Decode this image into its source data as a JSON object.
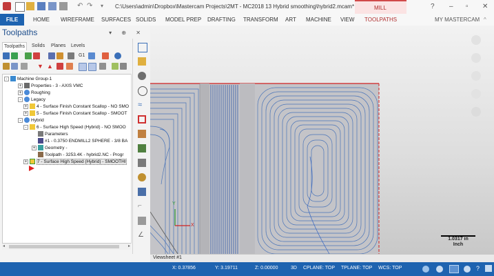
{
  "window": {
    "title": "C:\\Users\\admin\\Dropbox\\Mastercam Projects\\2MT - MC2018 13 Hybrid smoothing\\hybrid2.mcam* - Masterc...",
    "context_tab": "MILL",
    "accent": "#1e63b0",
    "context_color": "#b03030"
  },
  "ribbon": {
    "file": "FILE",
    "tabs": [
      "HOME",
      "WIREFRAME",
      "SURFACES",
      "SOLIDS",
      "MODEL PREP",
      "DRAFTING",
      "TRANSFORM",
      "ART",
      "MACHINE",
      "VIEW",
      "TOOLPATHS"
    ],
    "active_tab": "TOOLPATHS",
    "my_mastercam": "MY MASTERCAM"
  },
  "panel": {
    "title": "Toolpaths",
    "controls": "▾ ⊕ ✕",
    "tabs": [
      "Toolpaths",
      "Solids",
      "Planes",
      "Levels"
    ],
    "active_tab": "Toolpaths"
  },
  "tree": {
    "nodes": [
      {
        "label": "Machine Group-1",
        "icon": "machine-group-icon"
      },
      {
        "label": "Properties - 3 - AXIS VMC",
        "icon": "properties-icon"
      },
      {
        "label": "Roughing",
        "icon": "group-icon"
      },
      {
        "label": "Legacy",
        "icon": "group-icon"
      },
      {
        "label": "4 - Surface Finish Constant Scallop - NO SMO",
        "icon": "folder-icon"
      },
      {
        "label": "5 - Surface Finish Constant Scallop - SMOOT",
        "icon": "folder-icon"
      },
      {
        "label": "Hybrid",
        "icon": "group-icon"
      },
      {
        "label": "6 - Surface High Speed (Hybrid) - NO SMOO",
        "icon": "folder-icon"
      },
      {
        "label": "Parameters",
        "icon": "parameters-icon"
      },
      {
        "label": "#1 - 0.3750 ENDMILL2 SPHERE - 3/8 BA",
        "icon": "tool-icon"
      },
      {
        "label": "Geometry -",
        "icon": "geometry-icon"
      },
      {
        "label": "Toolpath - 3253.4K - hybrid2.NC - Progr",
        "icon": "toolpath-icon"
      },
      {
        "label": "7 - Surface High Speed (Hybrid) - SMOOTHI",
        "icon": "folder-icon",
        "selected": true
      },
      {
        "label": "",
        "icon": "insert-arrow-icon"
      }
    ]
  },
  "viewport": {
    "sheet_tab": "Viewsheet #1",
    "scale_value": "1.0317 in",
    "scale_unit": "Inch",
    "axis_x": "X",
    "axis_y": "Y"
  },
  "status": {
    "x": "X:  0.37856",
    "y": "Y:  3.19711",
    "z": "Z:  0.00000",
    "mode": "3D",
    "cplane": "CPLANE: TOP",
    "tplane": "TPLANE: TOP",
    "wcs": "WCS: TOP"
  }
}
